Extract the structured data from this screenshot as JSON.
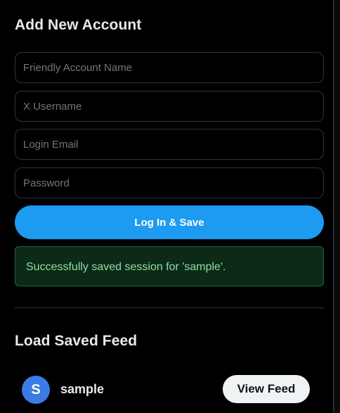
{
  "add_account": {
    "title": "Add New Account",
    "fields": {
      "friendly_name": {
        "value": "",
        "placeholder": "Friendly Account Name"
      },
      "username": {
        "value": "",
        "placeholder": "X Username"
      },
      "email": {
        "value": "",
        "placeholder": "Login Email"
      },
      "password": {
        "value": "",
        "placeholder": "Password"
      }
    },
    "submit_label": "Log In & Save",
    "status_message": "Successfully saved session for 'sample'."
  },
  "load_feed": {
    "title": "Load Saved Feed",
    "accounts": [
      {
        "avatar_letter": "S",
        "name": "sample",
        "action_label": "View Feed"
      }
    ]
  },
  "colors": {
    "background": "#000000",
    "accent": "#1d9bf0",
    "success_text": "#86e0a0",
    "success_bg": "#0d2918",
    "avatar": "#3b7be6"
  }
}
